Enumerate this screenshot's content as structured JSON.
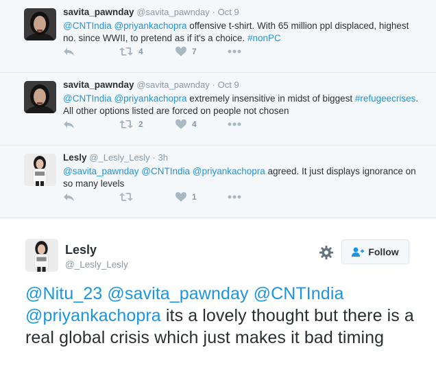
{
  "replies": [
    {
      "name": "savita_pawnday",
      "handle": "@savita_pawnday",
      "dot": "·",
      "time": "Oct 9",
      "text_parts": [
        {
          "t": "@CNTIndia @priyankachopra",
          "link": true
        },
        {
          "t": " offensive t-shirt. With 65 million ppl displaced, highest no. since WWII, to pretend as if it's a choice. ",
          "link": false
        },
        {
          "t": "#nonPC",
          "link": true
        }
      ],
      "retweets": "4",
      "likes": "7"
    },
    {
      "name": "savita_pawnday",
      "handle": "@savita_pawnday",
      "dot": "·",
      "time": "Oct 9",
      "text_parts": [
        {
          "t": "@CNTIndia @priyankachopra",
          "link": true
        },
        {
          "t": " extremely insensitive in midst of biggest ",
          "link": false
        },
        {
          "t": "#refugeecrises",
          "link": true
        },
        {
          "t": ". All other options listed are forced on people not chosen",
          "link": false
        }
      ],
      "retweets": "2",
      "likes": "4"
    },
    {
      "name": "Lesly",
      "handle": "@_Lesly_Lesly",
      "dot": "·",
      "time": "3h",
      "text_parts": [
        {
          "t": "@savita_pawnday @CNTIndia @priyankachopra",
          "link": true
        },
        {
          "t": " agreed. It just displays ignorance on so many levels",
          "link": false
        }
      ],
      "retweets": "",
      "likes": "1"
    }
  ],
  "main_tweet": {
    "name": "Lesly",
    "handle": "@_Lesly_Lesly",
    "follow_label": "Follow",
    "text_parts": [
      {
        "t": "@Nitu_23 @savita_pawnday @CNTIndia @priyankachopra",
        "link": true
      },
      {
        "t": " its a lovely thought but there is a real global crisis which just makes it bad timing",
        "link": false
      }
    ]
  },
  "icons": {
    "reply": "reply-icon",
    "retweet": "retweet-icon",
    "like": "heart-icon",
    "more": "more-icon",
    "gear": "gear-icon",
    "follow": "add-user-icon"
  },
  "colors": {
    "link": "#1b95e0",
    "muted": "#8899a6",
    "icon": "#aab8c2",
    "text": "#292f33",
    "reply_bg": "#f5f8fa"
  }
}
